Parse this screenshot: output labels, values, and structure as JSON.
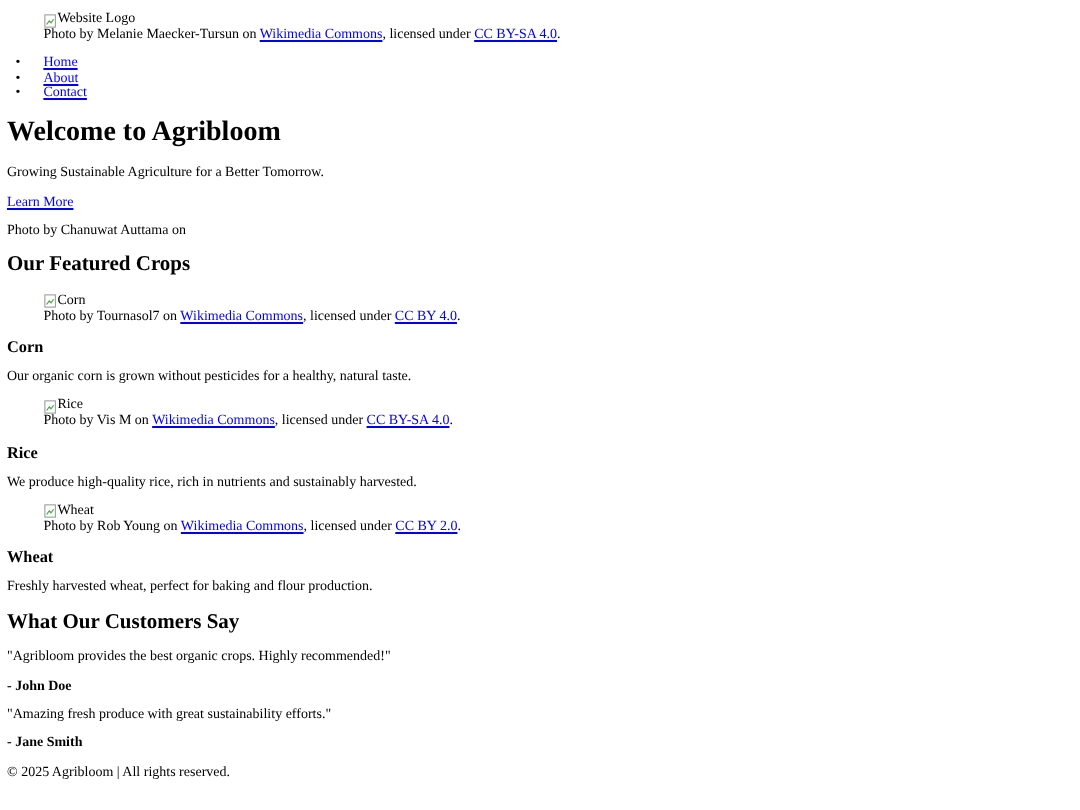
{
  "header": {
    "logo_alt": "Website Logo",
    "credit": {
      "prefix": "Photo by Melanie Maecker-Tursun on",
      "source": "Wikimedia Commons",
      "middle": ", licensed under",
      "license": "CC BY-SA 4.0",
      "end": "."
    }
  },
  "nav": [
    {
      "marker": "•",
      "label": "Home"
    },
    {
      "marker": "•",
      "label": "About"
    },
    {
      "marker": "•",
      "label": "Contact"
    }
  ],
  "hero": {
    "title": "Welcome to Agribloom",
    "tagline": "Growing Sustainable Agriculture for a Better Tomorrow.",
    "link": "Learn More",
    "credit": "Photo by Chanuwat Auttama on"
  },
  "crops": {
    "title": "Our Featured Crops",
    "items": [
      {
        "image_alt": "Corn",
        "credit": {
          "prefix": "Photo by Tournasol7 on",
          "source": "Wikimedia Commons",
          "middle": ", licensed under",
          "license": "CC BY 4.0",
          "end": "."
        },
        "name": "Corn",
        "description": "Our organic corn is grown without pesticides for a healthy, natural taste."
      },
      {
        "image_alt": "Rice",
        "credit": {
          "prefix": "Photo by Vis M on",
          "source": "Wikimedia Commons",
          "middle": ", licensed under",
          "license": "CC BY-SA 4.0",
          "end": "."
        },
        "name": "Rice",
        "description": "We produce high-quality rice, rich in nutrients and sustainably harvested."
      },
      {
        "image_alt": "Wheat",
        "credit": {
          "prefix": "Photo by Rob Young on",
          "source": "Wikimedia Commons",
          "middle": ", licensed under",
          "license": "CC BY 2.0",
          "end": "."
        },
        "name": "Wheat",
        "description": "Freshly harvested wheat, perfect for baking and flour production."
      }
    ]
  },
  "testimonials": {
    "title": "What Our Customers Say",
    "items": [
      {
        "quote": "\"Agribloom provides the best organic crops. Highly recommended!\"",
        "author": "- John Doe"
      },
      {
        "quote": "\"Amazing fresh produce with great sustainability efforts.\"",
        "author": "- Jane Smith"
      }
    ]
  },
  "footer": "© 2025 Agribloom | All rights reserved."
}
